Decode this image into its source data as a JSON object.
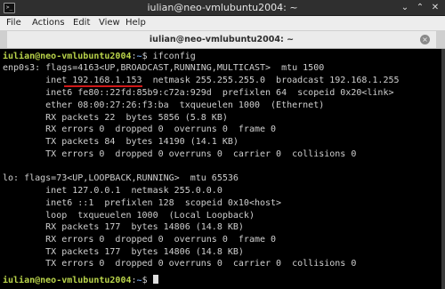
{
  "window": {
    "title": "iulian@neo-vmlubuntu2004: ~",
    "icon_glyph": ">_",
    "minimize_glyph": "⌄",
    "maximize_glyph": "⌃",
    "close_glyph": "✕"
  },
  "menu": {
    "file": "File",
    "actions": "Actions",
    "edit": "Edit",
    "view": "View",
    "help": "Help"
  },
  "tab": {
    "label": "iulian@neo-vmlubuntu2004: ~",
    "close_glyph": "×"
  },
  "terminal": {
    "prompt_user_host": "iulian@neo-vmlubuntu2004",
    "prompt_path": "~",
    "prompt_symbol": "$",
    "command": "ifconfig",
    "enp0s3": {
      "header": "enp0s3: flags=4163<UP,BROADCAST,RUNNING,MULTICAST>  mtu 1500",
      "inet": "        inet 192.168.1.153  netmask 255.255.255.0  broadcast 192.168.1.255",
      "inet6": "        inet6 fe80::22fd:85b9:c72a:929d  prefixlen 64  scopeid 0x20<link>",
      "ether": "        ether 08:00:27:26:f3:ba  txqueuelen 1000  (Ethernet)",
      "rx_packets": "        RX packets 22  bytes 5856 (5.8 KB)",
      "rx_errors": "        RX errors 0  dropped 0  overruns 0  frame 0",
      "tx_packets": "        TX packets 84  bytes 14190 (14.1 KB)",
      "tx_errors": "        TX errors 0  dropped 0 overruns 0  carrier 0  collisions 0"
    },
    "lo": {
      "header": "lo: flags=73<UP,LOOPBACK,RUNNING>  mtu 65536",
      "inet": "        inet 127.0.0.1  netmask 255.0.0.0",
      "inet6": "        inet6 ::1  prefixlen 128  scopeid 0x10<host>",
      "loop": "        loop  txqueuelen 1000  (Local Loopback)",
      "rx_packets": "        RX packets 177  bytes 14806 (14.8 KB)",
      "rx_errors": "        RX errors 0  dropped 0  overruns 0  frame 0",
      "tx_packets": "        TX packets 177  bytes 14806 (14.8 KB)",
      "tx_errors": "        TX errors 0  dropped 0 overruns 0  carrier 0  collisions 0"
    }
  },
  "colors": {
    "prompt_user": "#b9d34a",
    "prompt_path": "#6f9ee0",
    "highlight_underline": "#d01818",
    "terminal_bg": "#000000",
    "terminal_fg": "#cfcfcf"
  }
}
